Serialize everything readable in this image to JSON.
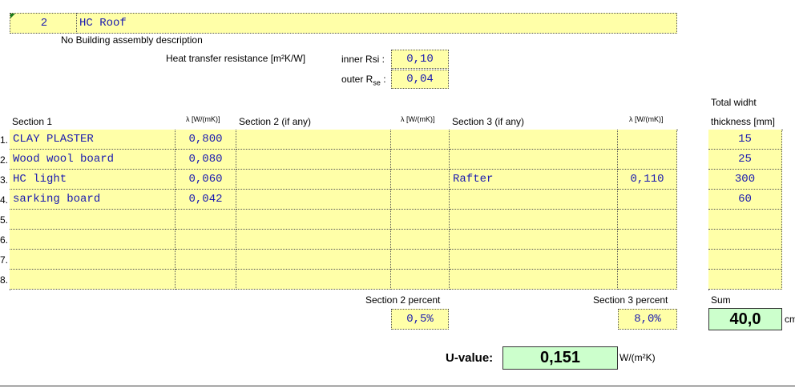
{
  "header": {
    "number": "2",
    "name": "HC Roof",
    "description": "No Building assembly description"
  },
  "resistance": {
    "label": "Heat transfer resistance [m²K/W]",
    "inner_label": "inner Rsi :",
    "inner_value": "0,10",
    "outer_label": "outer R",
    "outer_sub": "se",
    "outer_colon": ":",
    "outer_value": "0,04"
  },
  "columns": {
    "section1": "Section 1",
    "lambda": "λ [W/(mK)]",
    "section2": "Section 2 (if any)",
    "section3": "Section 3 (if any)",
    "total_top": "Total widht",
    "total_bottom": "thickness [mm]"
  },
  "rows": [
    {
      "num": "1.",
      "s1": "CLAY PLASTER",
      "l1": "0,800",
      "s2": "",
      "l2": "",
      "s3": "",
      "l3": "",
      "t": "15"
    },
    {
      "num": "2.",
      "s1": "Wood wool board",
      "l1": "0,080",
      "s2": "",
      "l2": "",
      "s3": "",
      "l3": "",
      "t": "25"
    },
    {
      "num": "3.",
      "s1": "HC light",
      "l1": "0,060",
      "s2": "",
      "l2": "",
      "s3": "Rafter",
      "l3": "0,110",
      "t": "300"
    },
    {
      "num": "4.",
      "s1": "sarking board",
      "l1": "0,042",
      "s2": "",
      "l2": "",
      "s3": "",
      "l3": "",
      "t": "60"
    },
    {
      "num": "5.",
      "s1": "",
      "l1": "",
      "s2": "",
      "l2": "",
      "s3": "",
      "l3": "",
      "t": ""
    },
    {
      "num": "6.",
      "s1": "",
      "l1": "",
      "s2": "",
      "l2": "",
      "s3": "",
      "l3": "",
      "t": ""
    },
    {
      "num": "7.",
      "s1": "",
      "l1": "",
      "s2": "",
      "l2": "",
      "s3": "",
      "l3": "",
      "t": ""
    },
    {
      "num": "8.",
      "s1": "",
      "l1": "",
      "s2": "",
      "l2": "",
      "s3": "",
      "l3": "",
      "t": ""
    }
  ],
  "percents": {
    "s2_label": "Section 2 percent",
    "s2_value": "0,5%",
    "s3_label": "Section 3 percent",
    "s3_value": "8,0%"
  },
  "sum": {
    "label": "Sum",
    "value": "40,0",
    "unit": "cm"
  },
  "uvalue": {
    "label": "U-value:",
    "value": "0,151",
    "unit": "W/(m²K)"
  },
  "colors": {
    "input_fill": "#ffffa8",
    "result_fill": "#ccffcc",
    "value_text": "#1a1ab0"
  }
}
